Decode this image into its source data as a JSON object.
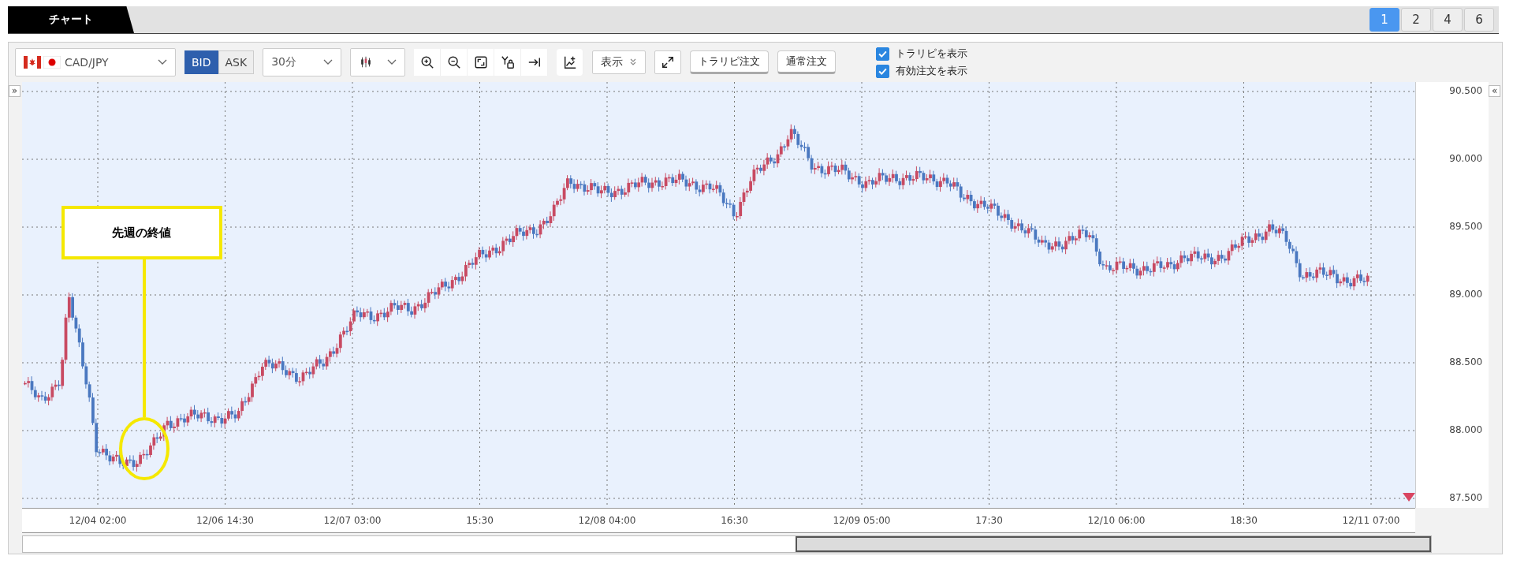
{
  "tab": {
    "label": "チャート"
  },
  "layout_buttons": [
    {
      "label": "1",
      "selected": true
    },
    {
      "label": "2",
      "selected": false
    },
    {
      "label": "4",
      "selected": false
    },
    {
      "label": "6",
      "selected": false
    }
  ],
  "toolbar": {
    "symbol": "CAD/JPY",
    "price_side": [
      {
        "label": "BID",
        "selected": true
      },
      {
        "label": "ASK",
        "selected": false
      }
    ],
    "timeframe": "30分",
    "display_button": "表示",
    "order_buttons": [
      "トラリピ注文",
      "通常注文"
    ],
    "options": [
      {
        "label": "トラリピを表示",
        "checked": true
      },
      {
        "label": "有効注文を表示",
        "checked": true
      }
    ]
  },
  "chart": {
    "expand_left": "»",
    "collapse_right": "«",
    "y_axis_labels": [
      "90.500",
      "90.000",
      "89.500",
      "89.000",
      "88.500",
      "88.000",
      "87.500"
    ],
    "x_axis_labels": [
      "12/04 02:00",
      "12/06 14:30",
      "12/07 03:00",
      "15:30",
      "12/08 04:00",
      "16:30",
      "12/09 05:00",
      "17:30",
      "12/10 06:00",
      "18:30",
      "12/11 07:00"
    ],
    "annotation": {
      "label": "先週の終値"
    }
  }
}
